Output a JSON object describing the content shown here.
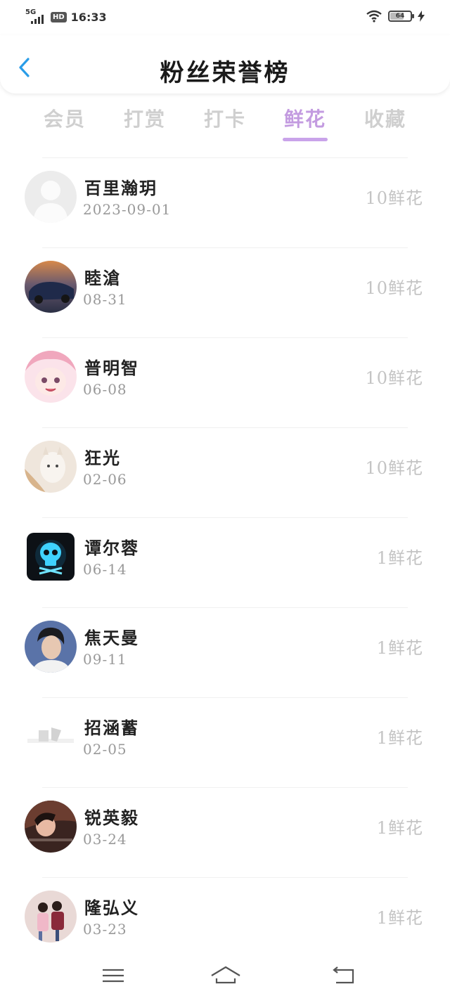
{
  "status_bar": {
    "network": "5G",
    "hd": "HD",
    "time": "16:33",
    "battery": "64",
    "battery_level": 0.64,
    "charging": true
  },
  "header": {
    "title": "粉丝荣誉榜",
    "back_icon": "chevron-left-icon"
  },
  "tabs": [
    {
      "label": "会员",
      "active": false
    },
    {
      "label": "打赏",
      "active": false
    },
    {
      "label": "打卡",
      "active": false
    },
    {
      "label": "鲜花",
      "active": true
    },
    {
      "label": "收藏",
      "active": false
    }
  ],
  "fans": [
    {
      "name": "百里瀚玥",
      "date": "2023-09-01",
      "amount": "10鲜花",
      "avatar": "default-avatar"
    },
    {
      "name": "睦滄",
      "date": "08-31",
      "amount": "10鲜花",
      "avatar": "car-photo"
    },
    {
      "name": "普明智",
      "date": "06-08",
      "amount": "10鲜花",
      "avatar": "anime-girl"
    },
    {
      "name": "狂光",
      "date": "02-06",
      "amount": "10鲜花",
      "avatar": "fox-photo"
    },
    {
      "name": "谭尔蓉",
      "date": "06-14",
      "amount": "1鲜花",
      "avatar": "skull-icon"
    },
    {
      "name": "焦天曼",
      "date": "09-11",
      "amount": "1鲜花",
      "avatar": "man-portrait"
    },
    {
      "name": "招涵蓄",
      "date": "02-05",
      "amount": "1鲜花",
      "avatar": "faded-graphic"
    },
    {
      "name": "锐英毅",
      "date": "03-24",
      "amount": "1鲜花",
      "avatar": "girl-portrait"
    },
    {
      "name": "隆弘义",
      "date": "03-23",
      "amount": "1鲜花",
      "avatar": "couple-photo"
    }
  ],
  "nav_bar": {
    "menu_icon": "menu-icon",
    "home_icon": "home-icon",
    "back_icon": "back-icon"
  }
}
